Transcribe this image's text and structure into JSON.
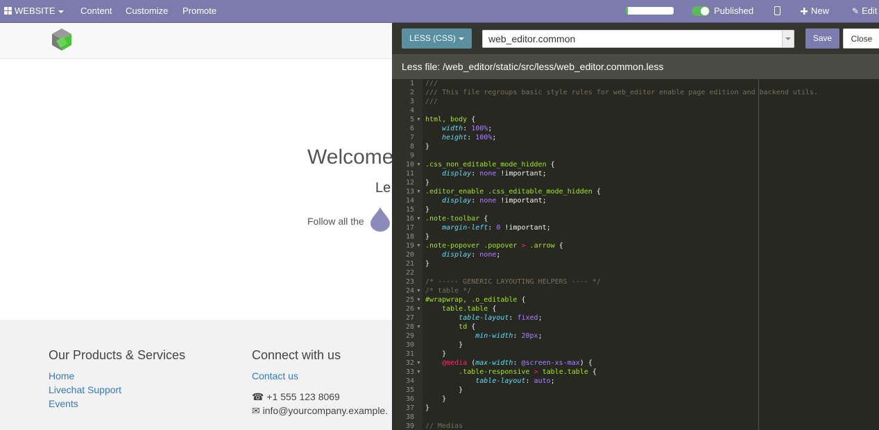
{
  "topbar": {
    "website_label": "WEBSITE",
    "menu": [
      "Content",
      "Customize",
      "Promote"
    ],
    "progress_fraction": 0.05,
    "published_label": "Published",
    "new_label": "New",
    "edit_label": "Edit"
  },
  "hero": {
    "title": "Welcome",
    "subtitle": "Le",
    "follow_text": "Follow all the"
  },
  "footer": {
    "products": {
      "heading": "Our Products & Services",
      "links": [
        "Home",
        "Livechat Support",
        "Events"
      ]
    },
    "connect": {
      "heading": "Connect with us",
      "contact_link": "Contact us",
      "phone": "+1 555 123 8069",
      "email": "info@yourcompany.example."
    }
  },
  "editor": {
    "type_button": "LESS (CSS)",
    "file_select": "web_editor.common",
    "save_label": "Save",
    "close_label": "Close",
    "file_path": "Less file: /web_editor/static/src/less/web_editor.common.less",
    "colors": {
      "comment": "#75715e",
      "selector": "#a6e22e",
      "property": "#66d9ef",
      "number": "#ae81ff",
      "keyword": "#f92672",
      "text": "#f8f8f2"
    },
    "lines": [
      [
        [
          "comment",
          "///"
        ]
      ],
      [
        [
          "comment",
          "/// This file regroups basic style rules for web_editor enable page edition and backend utils."
        ]
      ],
      [
        [
          "comment",
          "///"
        ]
      ],
      [],
      [
        [
          "selector",
          "html, body"
        ],
        [
          "text",
          " {"
        ]
      ],
      [
        [
          "text",
          "    "
        ],
        [
          "property",
          "width"
        ],
        [
          "text",
          ": "
        ],
        [
          "number",
          "100%"
        ],
        [
          "text",
          ";"
        ]
      ],
      [
        [
          "text",
          "    "
        ],
        [
          "property",
          "height"
        ],
        [
          "text",
          ": "
        ],
        [
          "number",
          "100%"
        ],
        [
          "text",
          ";"
        ]
      ],
      [
        [
          "text",
          "}"
        ]
      ],
      [],
      [
        [
          "selector",
          ".css_non_editable_mode_hidden"
        ],
        [
          "text",
          " {"
        ]
      ],
      [
        [
          "text",
          "    "
        ],
        [
          "property",
          "display"
        ],
        [
          "text",
          ": "
        ],
        [
          "number",
          "none"
        ],
        [
          "text",
          " !important;"
        ]
      ],
      [
        [
          "text",
          "}"
        ]
      ],
      [
        [
          "selector",
          ".editor_enable .css_editable_mode_hidden"
        ],
        [
          "text",
          " {"
        ]
      ],
      [
        [
          "text",
          "    "
        ],
        [
          "property",
          "display"
        ],
        [
          "text",
          ": "
        ],
        [
          "number",
          "none"
        ],
        [
          "text",
          " !important;"
        ]
      ],
      [
        [
          "text",
          "}"
        ]
      ],
      [
        [
          "selector",
          ".note-toolbar"
        ],
        [
          "text",
          " {"
        ]
      ],
      [
        [
          "text",
          "    "
        ],
        [
          "property",
          "margin-left"
        ],
        [
          "text",
          ": "
        ],
        [
          "number",
          "0"
        ],
        [
          "text",
          " !important;"
        ]
      ],
      [
        [
          "text",
          "}"
        ]
      ],
      [
        [
          "selector",
          ".note-popover .popover"
        ],
        [
          "text",
          " "
        ],
        [
          "keyword",
          ">"
        ],
        [
          "text",
          " "
        ],
        [
          "selector",
          ".arrow"
        ],
        [
          "text",
          " {"
        ]
      ],
      [
        [
          "text",
          "    "
        ],
        [
          "property",
          "display"
        ],
        [
          "text",
          ": "
        ],
        [
          "number",
          "none"
        ],
        [
          "text",
          ";"
        ]
      ],
      [
        [
          "text",
          "}"
        ]
      ],
      [],
      [
        [
          "comment",
          "/* ----- GENERIC LAYOUTING HELPERS ---- */"
        ]
      ],
      [
        [
          "comment",
          "/* table */"
        ]
      ],
      [
        [
          "selector",
          "#wrapwrap, .o_editable"
        ],
        [
          "text",
          " {"
        ]
      ],
      [
        [
          "text",
          "    "
        ],
        [
          "selector",
          "table.table"
        ],
        [
          "text",
          " {"
        ]
      ],
      [
        [
          "text",
          "        "
        ],
        [
          "property",
          "table-layout"
        ],
        [
          "text",
          ": "
        ],
        [
          "number",
          "fixed"
        ],
        [
          "text",
          ";"
        ]
      ],
      [
        [
          "text",
          "        "
        ],
        [
          "selector",
          "td"
        ],
        [
          "text",
          " {"
        ]
      ],
      [
        [
          "text",
          "            "
        ],
        [
          "property",
          "min-width"
        ],
        [
          "text",
          ": "
        ],
        [
          "number",
          "20px"
        ],
        [
          "text",
          ";"
        ]
      ],
      [
        [
          "text",
          "        }"
        ]
      ],
      [
        [
          "text",
          "    }"
        ]
      ],
      [
        [
          "text",
          "    "
        ],
        [
          "keyword",
          "@media"
        ],
        [
          "text",
          " ("
        ],
        [
          "property",
          "max-width"
        ],
        [
          "text",
          ": "
        ],
        [
          "number",
          "@screen-xs-max"
        ],
        [
          "text",
          ") {"
        ]
      ],
      [
        [
          "text",
          "        "
        ],
        [
          "selector",
          ".table-responsive"
        ],
        [
          "text",
          " "
        ],
        [
          "keyword",
          ">"
        ],
        [
          "text",
          " "
        ],
        [
          "selector",
          "table.table"
        ],
        [
          "text",
          " {"
        ]
      ],
      [
        [
          "text",
          "            "
        ],
        [
          "property",
          "table-layout"
        ],
        [
          "text",
          ": "
        ],
        [
          "number",
          "auto"
        ],
        [
          "text",
          ";"
        ]
      ],
      [
        [
          "text",
          "        }"
        ]
      ],
      [
        [
          "text",
          "    }"
        ]
      ],
      [
        [
          "text",
          "}"
        ]
      ],
      [],
      [
        [
          "comment",
          "// Medias"
        ]
      ]
    ],
    "folded_lines": [
      5,
      10,
      13,
      16,
      19,
      24,
      25,
      26,
      28,
      32,
      33
    ]
  }
}
